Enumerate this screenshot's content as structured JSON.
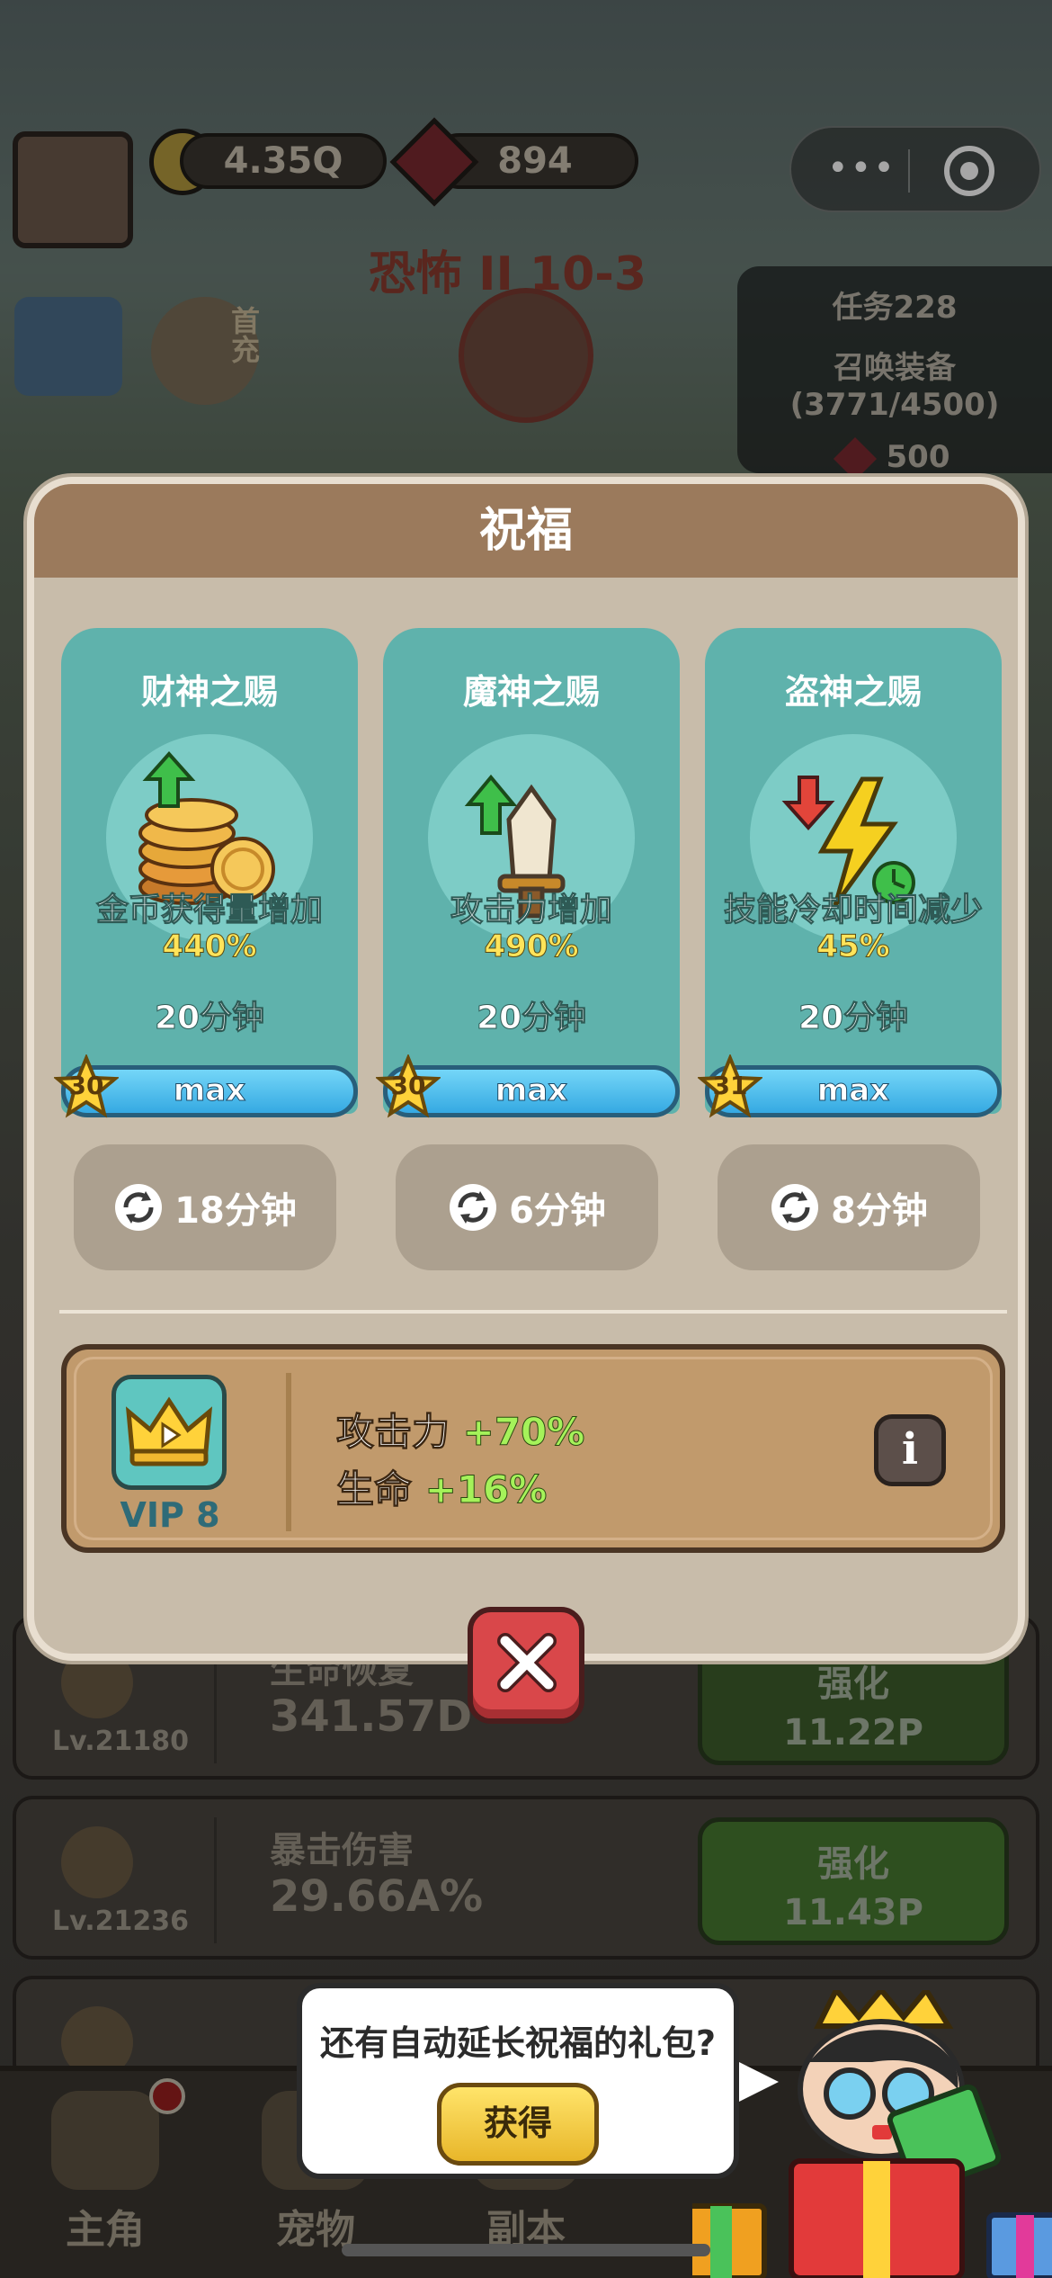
{
  "hud": {
    "gold": "4.35Q",
    "gems": "894",
    "stage": "恐怖 II 10-3",
    "first_recharge": "首充"
  },
  "task": {
    "title": "任务228",
    "desc": "召唤装备(3771/4500)",
    "reward": "500"
  },
  "modal": {
    "title": "祝福",
    "cards": [
      {
        "name": "财神之赐",
        "effect": "金币获得量增加",
        "value": "440%",
        "duration": "20分钟",
        "level": "30",
        "bar_label": "max",
        "cooldown": "18分钟",
        "art": "coins-icon",
        "art_color": "#e6a83a"
      },
      {
        "name": "魔神之赐",
        "effect": "攻击力增加",
        "value": "490%",
        "duration": "20分钟",
        "level": "30",
        "bar_label": "max",
        "cooldown": "6分钟",
        "art": "sword-icon",
        "art_color": "#f0e6d0"
      },
      {
        "name": "盗神之赐",
        "effect": "技能冷却时间减少",
        "value": "45%",
        "duration": "20分钟",
        "level": "31",
        "bar_label": "max",
        "cooldown": "8分钟",
        "art": "lightning-icon",
        "art_color": "#f5d020"
      }
    ],
    "vip": {
      "label": "VIP 8",
      "stat1_name": "攻击力",
      "stat1_value": "+70%",
      "stat2_name": "生命",
      "stat2_value": "+16%",
      "info": "i"
    }
  },
  "rows": [
    {
      "name": "生命恢复",
      "value": "341.57D",
      "level": "Lv.21180",
      "btn": "强化",
      "cost": "11.22P"
    },
    {
      "name": "暴击伤害",
      "value": "29.66A%",
      "level": "Lv.21236",
      "btn": "强化",
      "cost": "11.43P"
    }
  ],
  "promo": {
    "text": "还有自动延长祝福的礼包?",
    "button": "获得"
  },
  "nav": [
    "主角",
    "宠物",
    "副本"
  ],
  "colors": {
    "card_bg": "#5fb2ac",
    "header_bg": "#9b7a5c",
    "modal_bg": "#c8bcaa",
    "value_yellow": "#ffe45a",
    "stat_green": "#a5f25a",
    "close_red": "#d9474a"
  }
}
